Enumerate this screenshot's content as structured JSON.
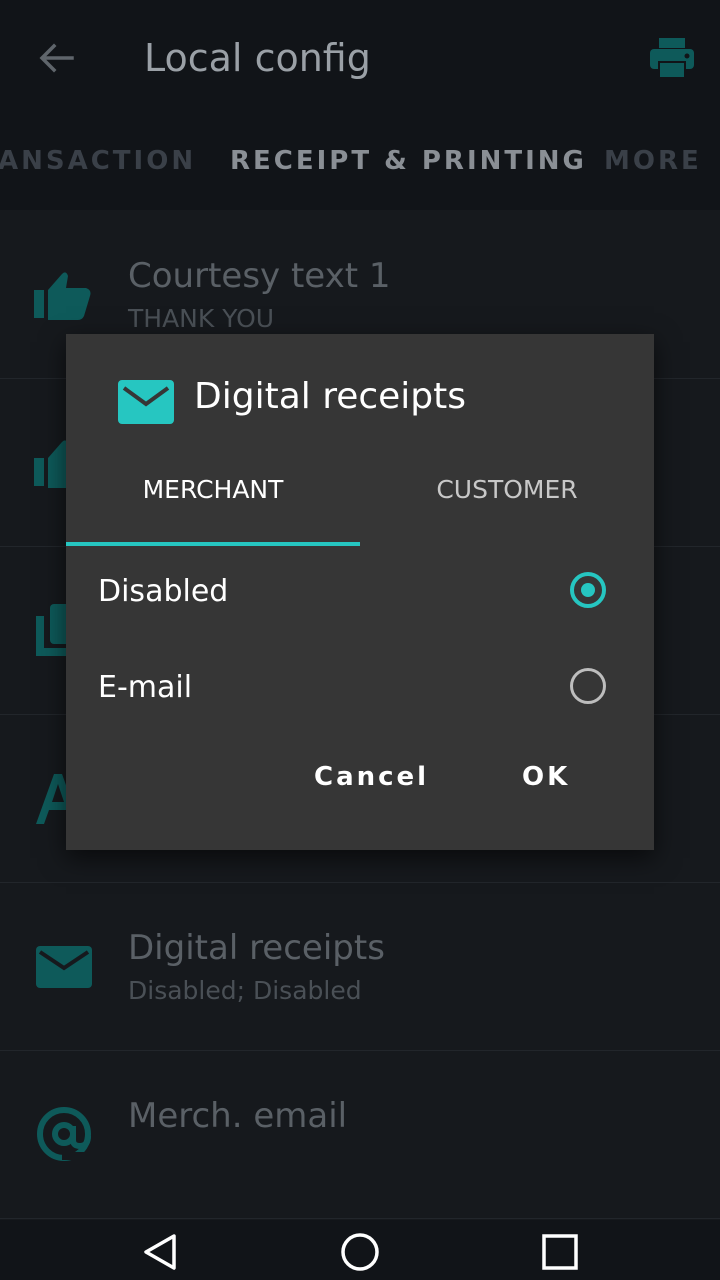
{
  "app_bar": {
    "title": "Local config",
    "back_icon": "arrow-left-icon",
    "print_icon": "printer-icon"
  },
  "tabs": [
    {
      "label": "ANSACTION",
      "active": false
    },
    {
      "label": "RECEIPT & PRINTING",
      "active": true
    },
    {
      "label": "MORE",
      "active": false
    }
  ],
  "settings": [
    {
      "icon": "thumb-up-icon",
      "label": "Courtesy text 1",
      "value": "THANK YOU"
    },
    {
      "icon": "thumb-up-icon",
      "label": "",
      "value": ""
    },
    {
      "icon": "copies-icon",
      "label": "",
      "value": ""
    },
    {
      "icon": "text-icon",
      "label": "",
      "value": ""
    },
    {
      "icon": "mail-icon",
      "label": "Digital receipts",
      "value": "Disabled; Disabled"
    },
    {
      "icon": "at-icon",
      "label": "Merch. email",
      "value": ""
    }
  ],
  "dialog": {
    "icon": "mail-icon",
    "title": "Digital receipts",
    "tabs": [
      {
        "label": "MERCHANT",
        "active": true
      },
      {
        "label": "CUSTOMER",
        "active": false
      }
    ],
    "options": [
      {
        "label": "Disabled",
        "selected": true
      },
      {
        "label": "E-mail",
        "selected": false
      }
    ],
    "cancel_label": "Cancel",
    "ok_label": "OK"
  },
  "nav": {
    "back_icon": "nav-back-icon",
    "home_icon": "nav-home-icon",
    "recents_icon": "nav-recents-icon"
  },
  "colors": {
    "accent": "#26c6c1",
    "dim_accent": "#0e5a5a",
    "dialog_bg": "#363636",
    "background": "#111418"
  }
}
